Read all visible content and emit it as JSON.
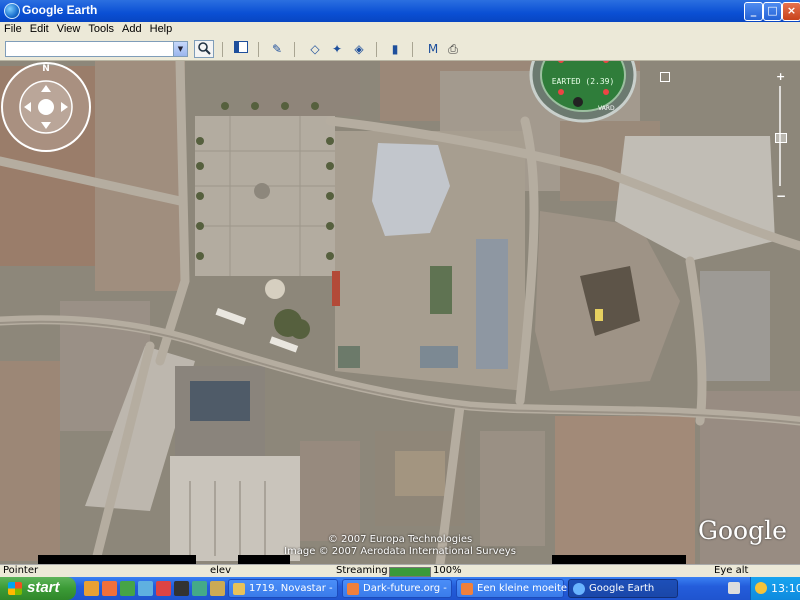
{
  "window": {
    "title": "Google Earth"
  },
  "title_buttons": {
    "minimize": "_",
    "maximize": "□",
    "close": "×"
  },
  "menu": [
    "File",
    "Edit",
    "View",
    "Tools",
    "Add",
    "Help"
  ],
  "search": {
    "value": ""
  },
  "overlay_widget": {
    "text": "EARTED (2.39)",
    "bottom": "VARD"
  },
  "navigation": {
    "north": "N"
  },
  "map": {
    "logo": "Google",
    "copyright_1": "© 2007 Europa Technologies",
    "copyright_2": "Image © 2007 Aerodata International Surveys"
  },
  "statusbar": {
    "pointer": "Pointer",
    "elev": "elev",
    "streaming": "Streaming",
    "streaming_percent": "100%",
    "eye_alt": "Eye alt"
  },
  "taskbar": {
    "start": "start",
    "tasks": [
      {
        "label": "1719. Novastar -",
        "color": "#e8c25a"
      },
      {
        "label": "Dark-future.org -",
        "color": "#f0803c"
      },
      {
        "label": "Een kleine moeite",
        "color": "#f0803c"
      },
      {
        "label": "Google Earth",
        "color": "#6ab4ff"
      }
    ],
    "clock": "13:10"
  },
  "colors": {
    "title_bar": "#0a4fd4",
    "taskbar": "#245ddb",
    "start_button": "#3b9b36"
  }
}
